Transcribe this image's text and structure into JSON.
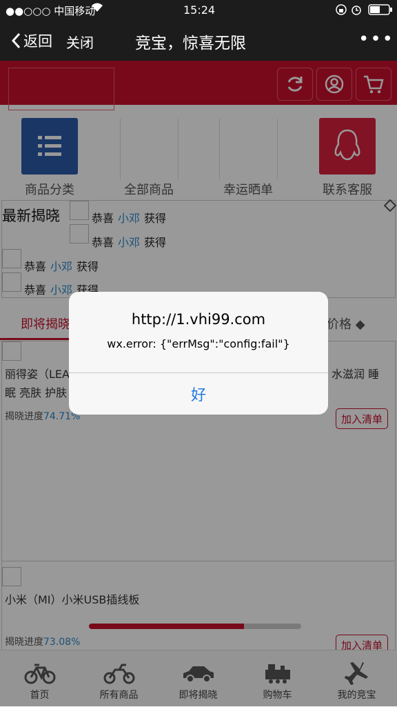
{
  "status": {
    "carrier": "●●○○○ 中国移动",
    "time": "15:24"
  },
  "nav": {
    "back_label": "返回",
    "close_label": "关闭",
    "title": "竞宝，惊喜无限",
    "more": "•••"
  },
  "quick_nav": [
    {
      "label": "商品分类",
      "color": "#2b5aa8"
    },
    {
      "label": "全部商品"
    },
    {
      "label": "幸运晒单"
    },
    {
      "label": "联系客服",
      "color": "#d8213e"
    }
  ],
  "reveal": {
    "title": "最新揭晓",
    "items": [
      {
        "prefix": "恭喜",
        "name": "小邓",
        "suffix": "获得"
      },
      {
        "prefix": "恭喜",
        "name": "小邓",
        "suffix": "获得"
      },
      {
        "prefix": "恭喜",
        "name": "小邓",
        "suffix": "获得"
      },
      {
        "prefix": "恭喜",
        "name": "小邓",
        "suffix": "获得"
      }
    ]
  },
  "tabs": {
    "first": "即将揭晓",
    "price": "价格 ◆"
  },
  "products": [
    {
      "name_left": "丽得姿（LEA",
      "name_right": "水滋润 睡",
      "name_line2": "眠 亮肤 护肤",
      "progress_label": "揭晓进度",
      "progress_value": "74.71%",
      "progress": 0.7471,
      "add_label": "加入清单"
    },
    {
      "name": "小米（MI）小米USB插线板",
      "progress_label": "揭晓进度",
      "progress_value": "73.08%",
      "progress": 0.7308,
      "add_label": "加入清单"
    }
  ],
  "tabbar": [
    {
      "label": "首页",
      "icon": "bicycle-icon"
    },
    {
      "label": "所有商品",
      "icon": "motorcycle-icon"
    },
    {
      "label": "即将揭晓",
      "icon": "car-icon"
    },
    {
      "label": "购物车",
      "icon": "train-icon"
    },
    {
      "label": "我的竞宝",
      "icon": "airplane-icon"
    }
  ],
  "alert": {
    "title": "http://1.vhi99.com",
    "message": "wx.error: {\"errMsg\":\"config:fail\"}",
    "ok_label": "好"
  },
  "colors": {
    "brand_red": "#c8102e",
    "link_blue": "#2a87c8",
    "ios_blue": "#1f7ae0"
  }
}
